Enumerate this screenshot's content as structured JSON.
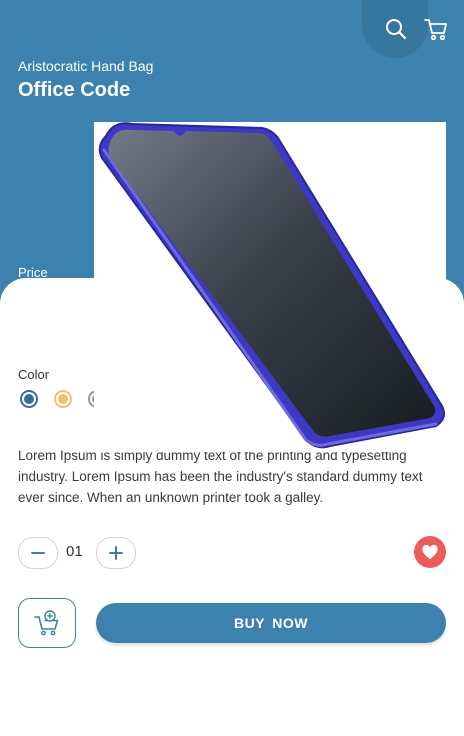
{
  "header": {
    "subtitle": "Aristocratic Hand Bag",
    "title": "Office Code",
    "price_label": "Price"
  },
  "product": {
    "image_icon": "smartphone-image"
  },
  "colors": {
    "label": "Color",
    "swatches": [
      "#356f98",
      "#f3c071",
      "#9a9a9a"
    ]
  },
  "description": "Lorem Ipsum is simply dummy text of the printing and typesetting industry. Lorem Ipsum has been the industry's standard dummy text ever since. When an unknown printer took a galley.",
  "quantity": {
    "value": "01"
  },
  "actions": {
    "buy_label": "BUY  NOW"
  },
  "theme": {
    "primary": "#3d82ae",
    "favorite": "#ed5b5b"
  }
}
